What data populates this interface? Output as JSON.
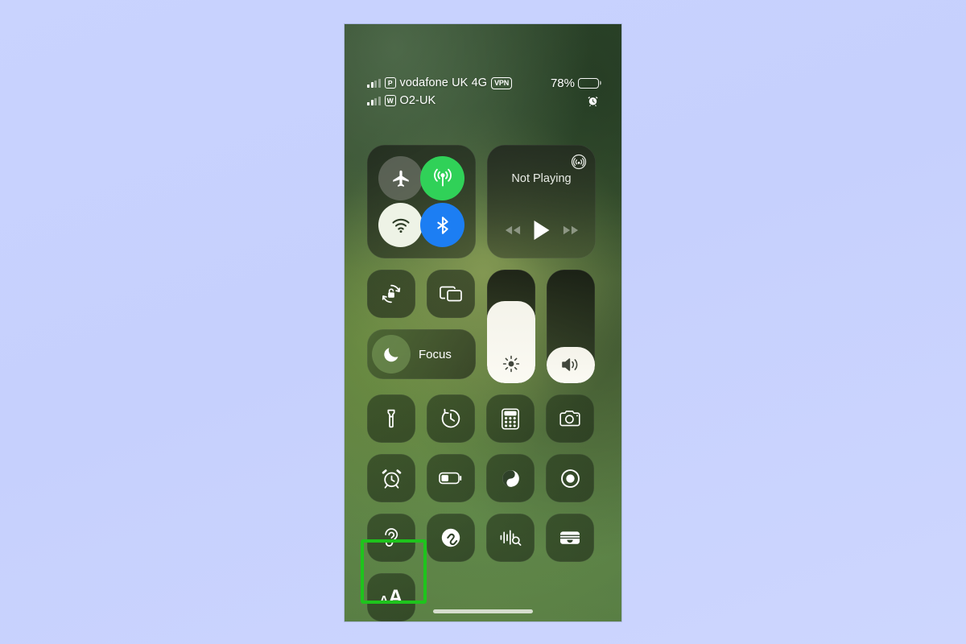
{
  "background_color": "#c8d2fd",
  "highlight_color": "#1ec41c",
  "status_bar": {
    "lines": [
      {
        "carrier": "vodafone UK 4G",
        "sim_badge": "P",
        "vpn_label": "VPN"
      },
      {
        "carrier": "O2-UK",
        "sim_badge": "W",
        "vpn_label": ""
      }
    ],
    "battery_percent": "78%",
    "battery_level": 78,
    "alarm_icon": "alarm-clock-icon"
  },
  "control_center": {
    "connectivity": {
      "airplane": {
        "name": "airplane-mode",
        "state": "off",
        "color": "#787d73"
      },
      "cellular": {
        "name": "cellular-data",
        "state": "on",
        "color": "#30d158"
      },
      "wifi": {
        "name": "wifi",
        "state": "on",
        "color": "#eef3e6"
      },
      "bluetooth": {
        "name": "bluetooth",
        "state": "on",
        "color": "#1c7ef3"
      }
    },
    "media": {
      "title": "Not Playing",
      "airplay_icon": "airplay-audio-icon",
      "controls": [
        "rewind-button",
        "play-button",
        "fast-forward-button"
      ]
    },
    "rotation_lock": {
      "name": "rotation-lock",
      "state": "off"
    },
    "screen_mirroring": {
      "name": "screen-mirroring"
    },
    "focus": {
      "label": "Focus",
      "icon": "moon-icon"
    },
    "brightness": {
      "name": "brightness-slider",
      "value": 72,
      "icon": "sun-icon"
    },
    "volume": {
      "name": "volume-slider",
      "value": 32,
      "icon": "speaker-icon"
    },
    "tiles": [
      {
        "name": "flashlight",
        "icon": "flashlight-icon"
      },
      {
        "name": "timer",
        "icon": "timer-icon"
      },
      {
        "name": "calculator",
        "icon": "calculator-icon"
      },
      {
        "name": "camera",
        "icon": "camera-icon"
      },
      {
        "name": "alarm",
        "icon": "alarm-icon"
      },
      {
        "name": "low-power-mode",
        "icon": "battery-low-icon"
      },
      {
        "name": "dark-mode",
        "icon": "dark-mode-icon"
      },
      {
        "name": "screen-recording",
        "icon": "record-icon"
      },
      {
        "name": "hearing",
        "icon": "ear-icon"
      },
      {
        "name": "shazam",
        "icon": "shazam-icon"
      },
      {
        "name": "sound-recognition",
        "icon": "sound-recognition-icon"
      },
      {
        "name": "wallet",
        "icon": "wallet-icon"
      }
    ],
    "text_size": {
      "label_small": "A",
      "label_large": "A",
      "name": "text-size",
      "highlighted": true
    }
  },
  "home_indicator": "home-indicator"
}
